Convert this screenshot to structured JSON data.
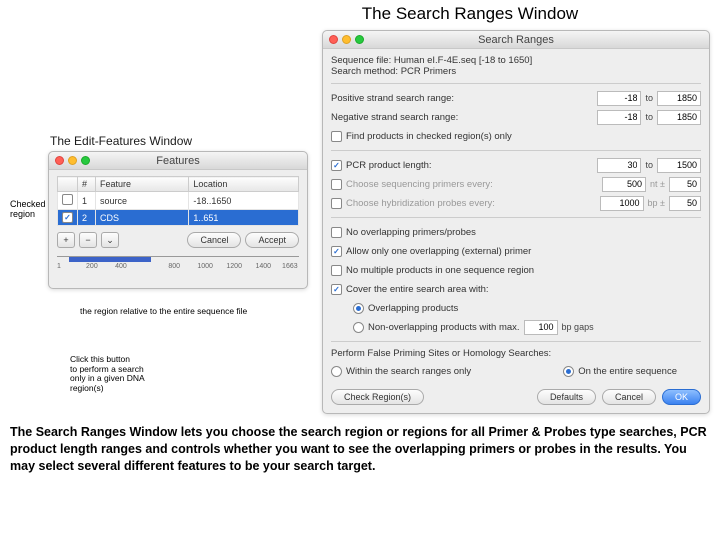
{
  "page_title": "The Search Ranges Window",
  "left": {
    "subtitle": "The Edit-Features Window",
    "window_title": "Features",
    "checked_label": "Checked\nregion",
    "columns": {
      "c1": "#",
      "c2": "Feature",
      "c3": "Location"
    },
    "rows": [
      {
        "n": "1",
        "feat": "source",
        "loc": "-18..1650"
      },
      {
        "n": "2",
        "feat": "CDS",
        "loc": "1..651"
      }
    ],
    "btn_plus": "+",
    "btn_minus": "−",
    "btn_pick": "⌄",
    "btn_cancel": "Cancel",
    "btn_accept": "Accept",
    "ruler_ticks": [
      "1",
      "200",
      "400",
      "800",
      "1000",
      "1200",
      "1400",
      "1663"
    ],
    "ann_ruler": "the region relative to the entire sequence file",
    "ann_click": "Click this button\nto perform a search\nonly in a given DNA\nregion(s)"
  },
  "right": {
    "window_title": "Search Ranges",
    "seq_line": "Sequence file:  Human eI.F-4E.seq  [-18 to 1650]",
    "method_line": "Search method:  PCR Primers",
    "row_pos": "Positive strand search range:",
    "row_neg": "Negative strand search range:",
    "pos_from": "-18",
    "pos_to": "1850",
    "neg_from": "-18",
    "neg_to": "1850",
    "chk_find": "Find products in checked region(s) only",
    "pcr_label": "PCR product length:",
    "pcr_from": "30",
    "pcr_to": "1500",
    "seq_primers": "Choose sequencing primers every:",
    "seq_val": "500",
    "seq_unit": "nt ±",
    "seq_tol": "50",
    "hyb_primers": "Choose hybridization probes every:",
    "hyb_val": "1000",
    "hyb_unit": "bp ±",
    "hyb_tol": "50",
    "chk_noover": "No overlapping primers/probes",
    "chk_allow": "Allow only one overlapping (external) primer",
    "chk_nomult": "No multiple products in one sequence region",
    "chk_cover": "Cover the entire search area with:",
    "rdo_over": "Overlapping products",
    "rdo_nonover": "Non-overlapping products with max.",
    "gap_val": "100",
    "gap_unit": "bp gaps",
    "false_label": "Perform False Priming Sites or Homology Searches:",
    "rdo_within": "Within the search ranges only",
    "rdo_entire": "On the entire sequence",
    "btn_check": "Check Region(s)",
    "btn_defaults": "Defaults",
    "btn_cancel": "Cancel",
    "btn_ok": "OK",
    "to": "to"
  },
  "description": "The Search Ranges Window lets you choose the search region or regions for all Primer & Probes type searches, PCR product length ranges and controls whether you want to see the overlapping primers or probes in the results. You may select several different features to be your search target."
}
